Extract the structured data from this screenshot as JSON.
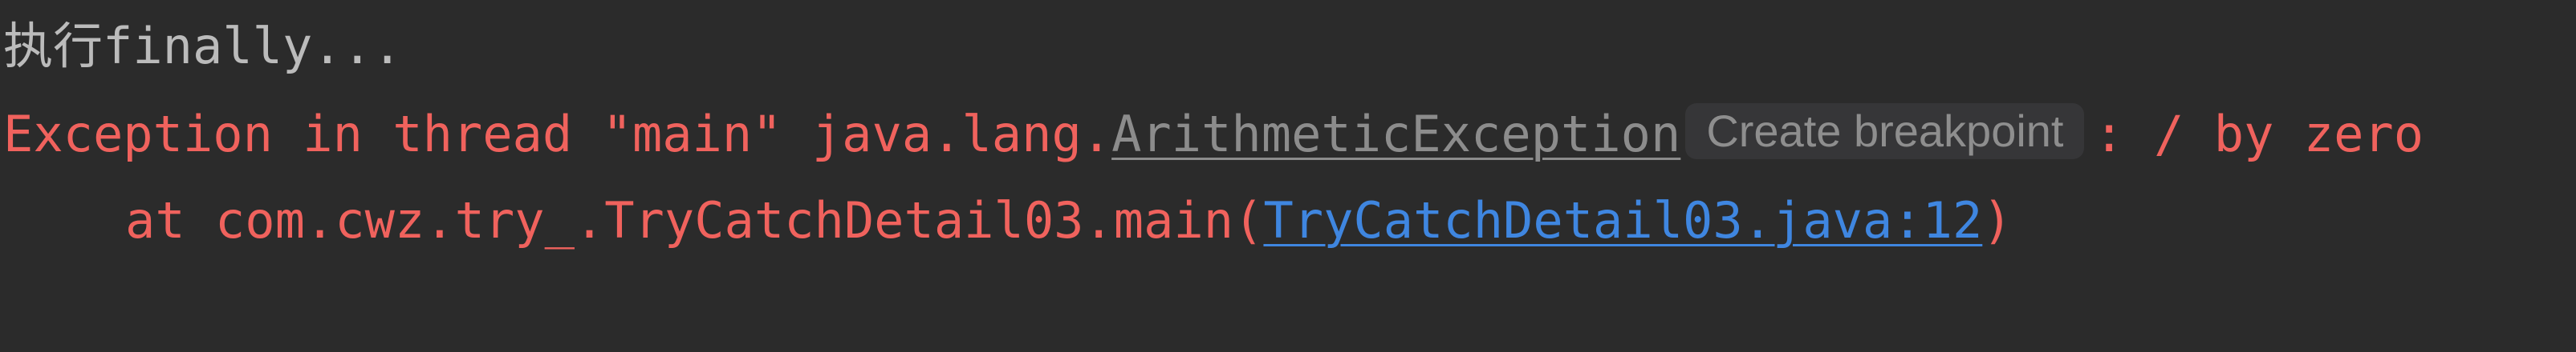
{
  "console": {
    "line1": {
      "cjk_prefix": "执行",
      "text": "finally..."
    },
    "line2": {
      "prefix": "Exception in thread \"main\" java.lang.",
      "exception_class": "ArithmeticException",
      "breakpoint_chip": "Create breakpoint",
      "suffix": ": / by zero"
    },
    "line3": {
      "prefix": "at com.cwz.try_.TryCatchDetail03.main(",
      "source_link": "TryCatchDetail03.java:12",
      "suffix": ")"
    }
  },
  "colors": {
    "background": "#2b2b2b",
    "stdout_text": "#bbbbbb",
    "stderr_text": "#f0625d",
    "exception_link": "#8c8c8c",
    "source_link": "#3f86e0",
    "chip_background": "#363638"
  }
}
